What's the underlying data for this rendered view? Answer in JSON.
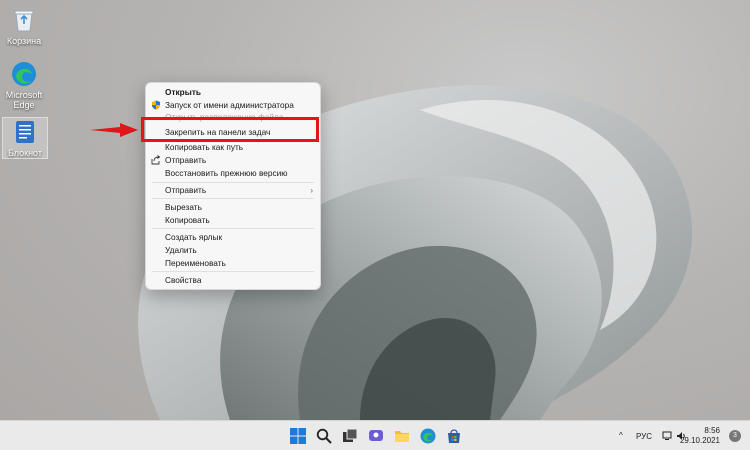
{
  "desktop": {
    "icons": [
      {
        "label": "Корзина",
        "icon": "recycle-bin-icon"
      },
      {
        "label": "Microsoft Edge",
        "icon": "edge-icon"
      },
      {
        "label": "Блокнот",
        "icon": "notepad-icon"
      }
    ]
  },
  "context_menu": {
    "items": [
      {
        "label": "Открыть",
        "bold": true
      },
      {
        "label": "Запуск от имени администратора",
        "icon": "shield-icon"
      },
      {
        "label": "Открыть расположение файла",
        "obscured": true
      },
      {
        "label": "Закрепить на панели задач",
        "highlighted": true
      },
      {
        "label": "Копировать как путь"
      },
      {
        "label": "Отправить",
        "icon": "share-icon"
      },
      {
        "label": "Восстановить прежнюю версию"
      },
      {
        "label": "Отправить",
        "submenu": true
      },
      {
        "label": "Вырезать"
      },
      {
        "label": "Копировать"
      },
      {
        "label": "Создать ярлык"
      },
      {
        "label": "Удалить"
      },
      {
        "label": "Переименовать"
      },
      {
        "label": "Свойства"
      }
    ],
    "highlight_color": "#e0161b"
  },
  "taskbar": {
    "apps": [
      "start-icon",
      "search-icon",
      "task-view-icon",
      "chat-icon",
      "file-explorer-icon",
      "edge-icon",
      "store-icon"
    ],
    "tray": {
      "chevron": "^",
      "language": "РУС",
      "time": "8:56",
      "date": "29.10.2021",
      "notifications": "3"
    }
  }
}
